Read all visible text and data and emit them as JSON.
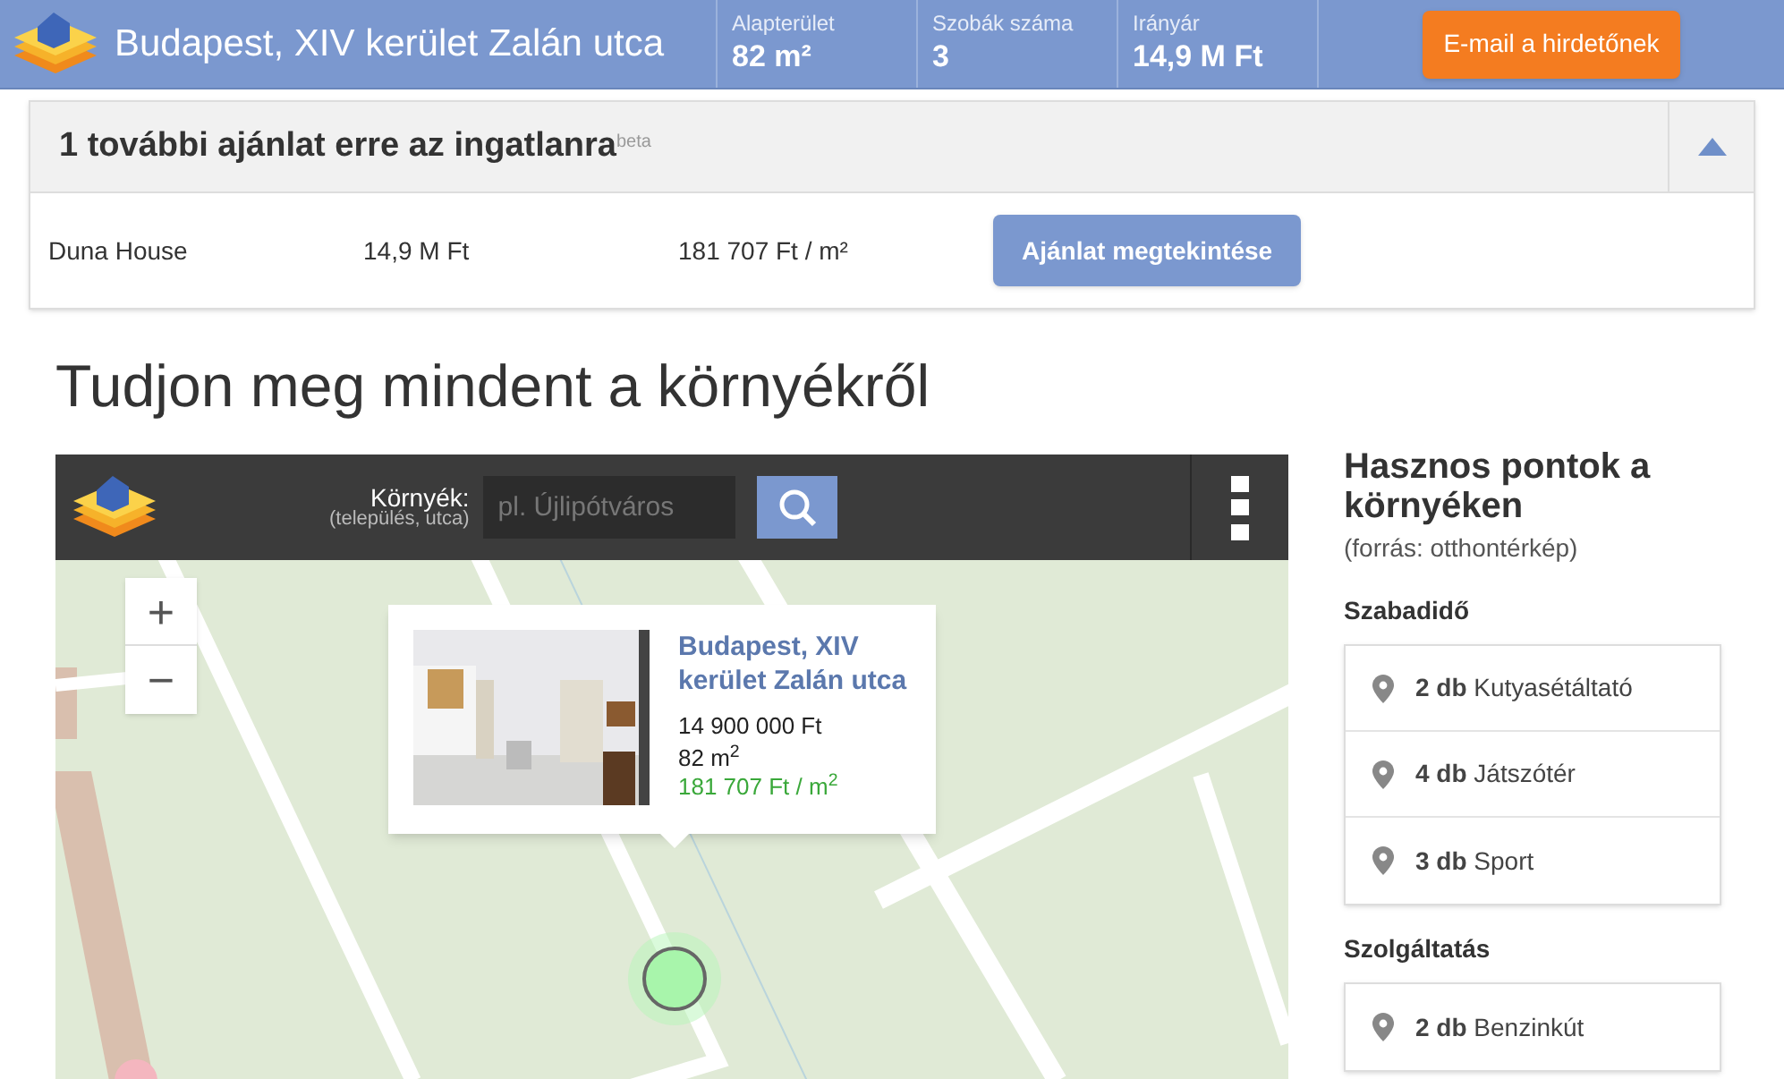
{
  "header": {
    "title": "Budapest, XIV kerület Zalán utca",
    "stats": [
      {
        "label": "Alapterület",
        "value": "82 m²"
      },
      {
        "label": "Szobák száma",
        "value": "3"
      },
      {
        "label": "Irányár",
        "value": "14,9 M Ft"
      }
    ],
    "email_button": "E-mail a hirdetőnek"
  },
  "offers": {
    "title": "1 további ajánlat erre az ingatlanra",
    "badge": "beta",
    "expanded": true,
    "rows": [
      {
        "agency": "Duna House",
        "price": "14,9 M Ft",
        "unit_price": "181 707 Ft / m²",
        "button": "Ajánlat megtekintése"
      }
    ]
  },
  "section_title": "Tudjon meg mindent a környékről",
  "map": {
    "search_label": "Környék:",
    "search_hint": "(település, utca)",
    "placeholder": "pl. Újlipótváros",
    "zoom_in": "+",
    "zoom_out": "−",
    "popup": {
      "title": "Budapest, XIV kerület Zalán utca",
      "price": "14 900 000 Ft",
      "area": "82 m$^{2}$",
      "unit_price": "181 707 Ft / m$^{2}$"
    }
  },
  "sidebar": {
    "title": "Hasznos pontok a környéken",
    "source": "(forrás: otthontérkép)",
    "groups": [
      {
        "name": "Szabadidő",
        "items": [
          "**2 db** Kutyasétáltató",
          "**4 db** Játszótér",
          "**3 db** Sport"
        ]
      },
      {
        "name": "Szolgáltatás",
        "items": [
          "**2 db** Benzinkút"
        ]
      }
    ]
  }
}
